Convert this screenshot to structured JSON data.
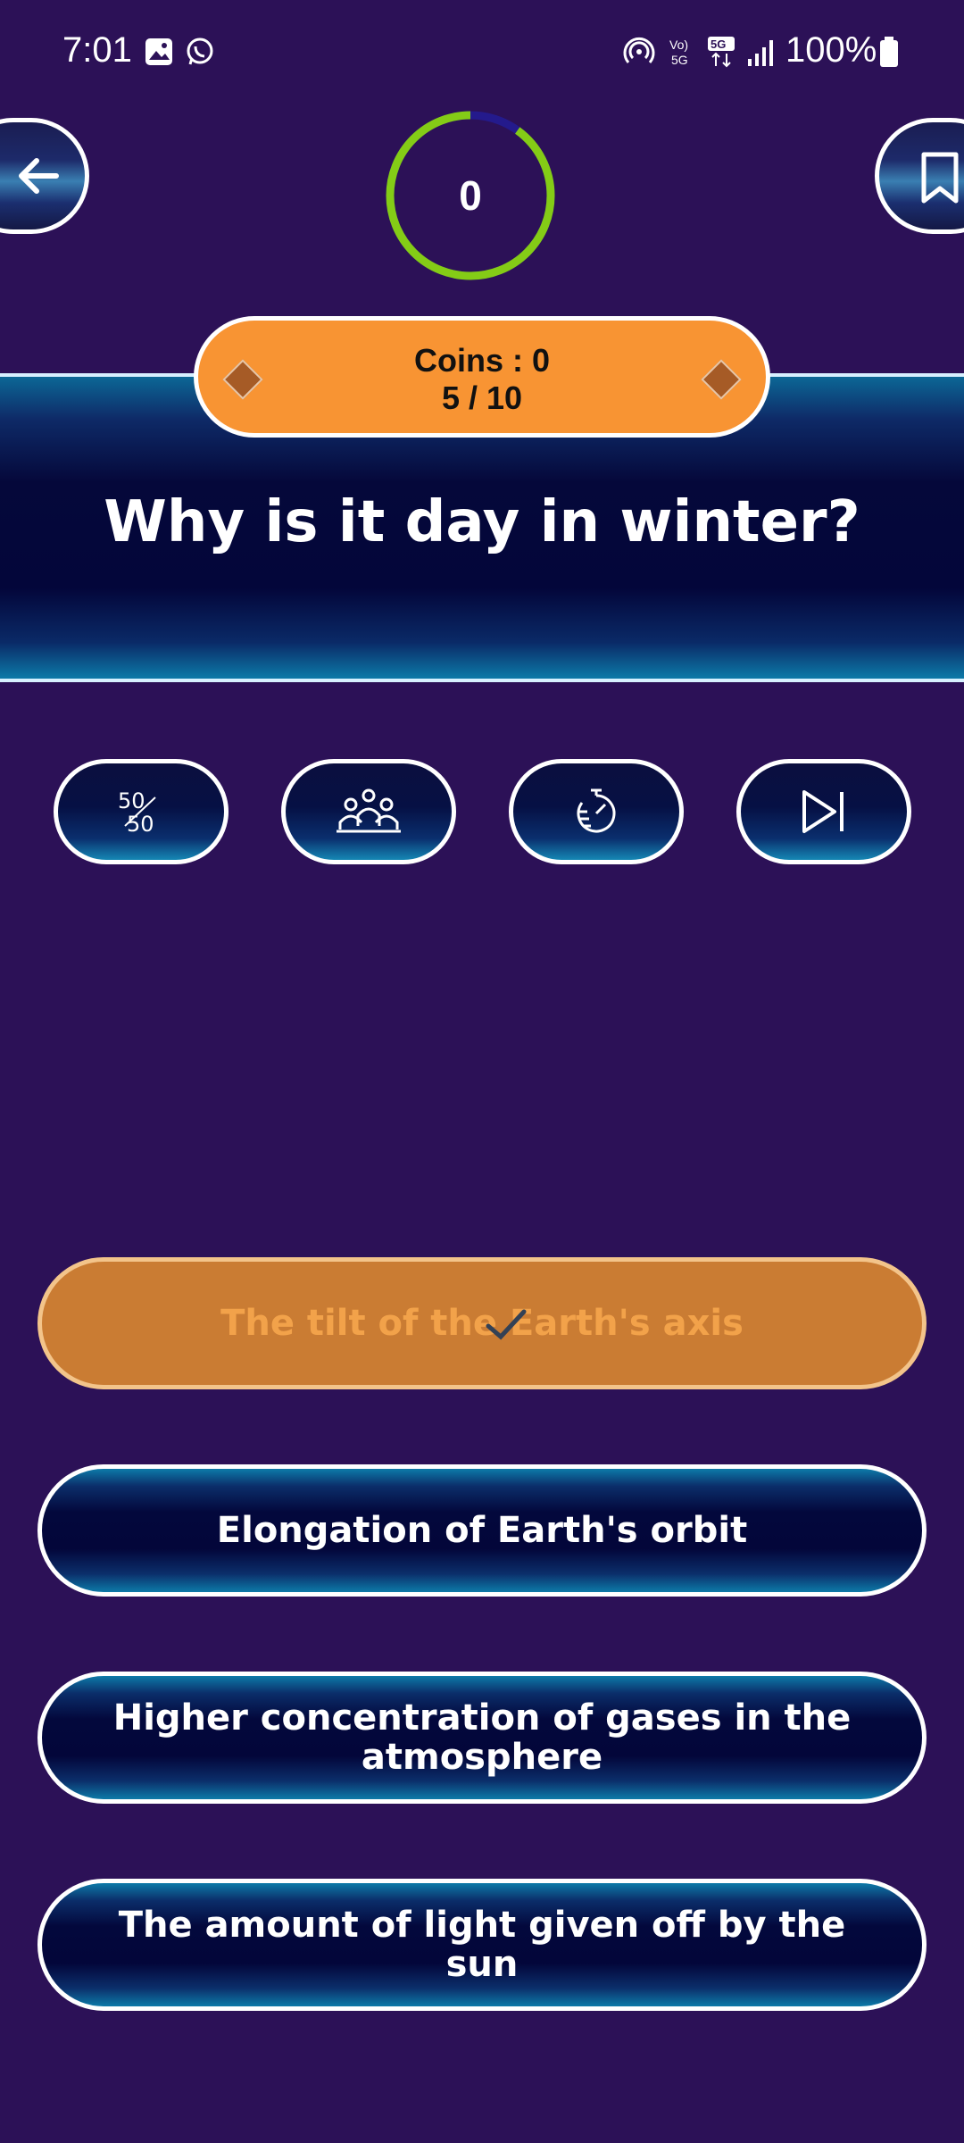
{
  "status_bar": {
    "time": "7:01",
    "battery": "100%",
    "icons": [
      "gallery-icon",
      "whatsapp-icon",
      "hotspot-icon",
      "volte-icon",
      "5g-icon",
      "signal-icon",
      "battery-icon"
    ]
  },
  "header": {
    "timer_value": "0",
    "timer_progress": 0.9,
    "coins_label": "Coins : 0",
    "progress_label": "5 / 10"
  },
  "question": {
    "text": "Why is it day in winter?"
  },
  "lifelines": [
    {
      "name": "fifty-fifty",
      "icon": "fifty-fifty-icon"
    },
    {
      "name": "audience-poll",
      "icon": "audience-icon"
    },
    {
      "name": "add-time",
      "icon": "stopwatch-icon"
    },
    {
      "name": "skip",
      "icon": "skip-icon"
    }
  ],
  "answers": [
    {
      "text": "The tilt of the Earth's axis",
      "selected": true
    },
    {
      "text": "Elongation of Earth's orbit",
      "selected": false
    },
    {
      "text": "Higher concentration of gases in the atmosphere",
      "selected": false
    },
    {
      "text": "The amount of light given off by the sun",
      "selected": false
    }
  ],
  "colors": {
    "background": "#2c1157",
    "accent_orange": "#f89433",
    "selected_answer": "#ca7c33",
    "timer_green": "#84cc16",
    "timer_track": "#241a8c"
  }
}
